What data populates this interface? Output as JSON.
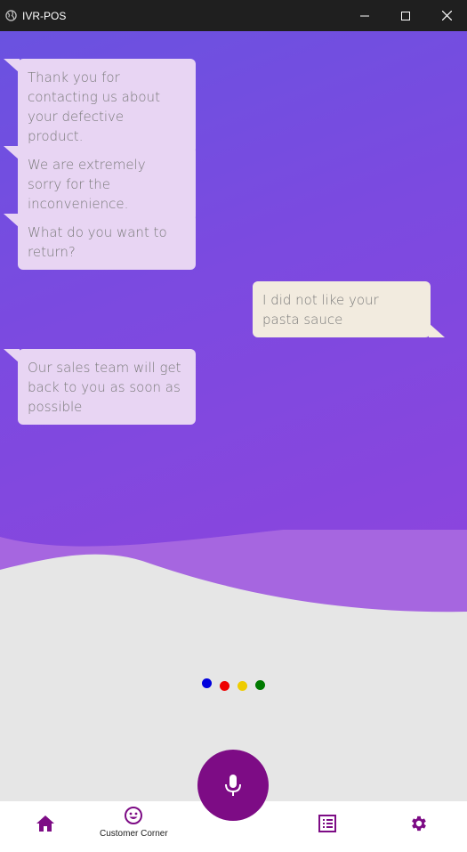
{
  "window": {
    "title": "IVR-POS",
    "icon": "globe-icon",
    "controls": [
      "minimize-icon",
      "maximize-icon",
      "close-icon"
    ]
  },
  "messages": [
    {
      "sender": "bot",
      "text": "Thank you for contacting us about your defective product."
    },
    {
      "sender": "bot",
      "text": "We are extremely sorry for the inconvenience."
    },
    {
      "sender": "bot",
      "text": "What do you want to return?"
    },
    {
      "sender": "user",
      "text": "I did not like your pasta sauce"
    },
    {
      "sender": "bot",
      "text": "Our sales team will get back to you as soon as possible"
    }
  ],
  "indicator_dots": [
    "#0000dd",
    "#ee0000",
    "#eecc00",
    "#007a00"
  ],
  "nav": {
    "home_icon": "home-icon",
    "customer_corner_label": "Customer Corner",
    "customer_corner_icon": "smiley-icon",
    "mic_icon": "microphone-icon",
    "list_icon": "list-icon",
    "settings_icon": "gear-icon"
  },
  "colors": {
    "accent": "#7d0c85",
    "bot_bubble": "#e8d5f3",
    "user_bubble": "#f2ebdf",
    "gradient_start": "#6a52e0",
    "gradient_end": "#8e44dd"
  }
}
